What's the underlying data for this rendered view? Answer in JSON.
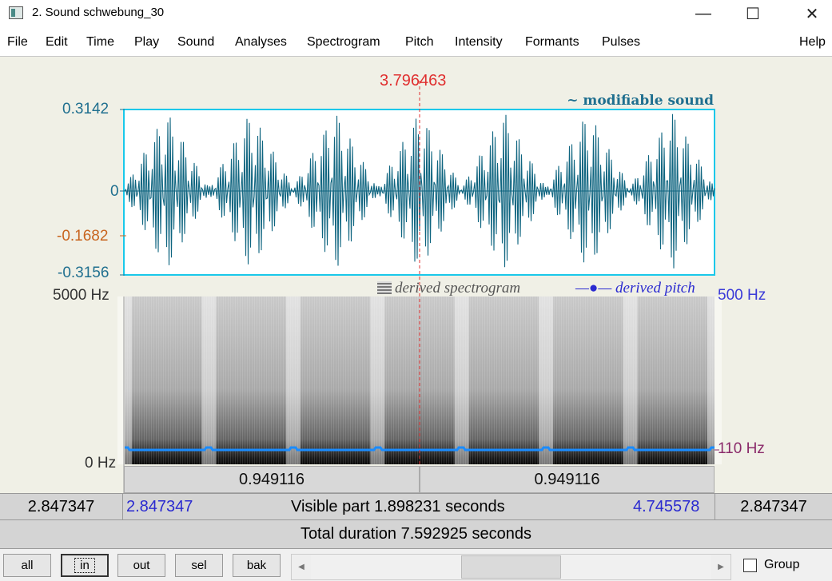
{
  "window": {
    "title": "2. Sound schwebung_30",
    "minimize": "—",
    "maximize": "☐",
    "close": "✕"
  },
  "menu": [
    "File",
    "Edit",
    "Time",
    "Play",
    "Sound",
    "Analyses",
    "Spectrogram",
    "Pitch",
    "Intensity",
    "Formants",
    "Pulses",
    "Help"
  ],
  "cursor_time": "3.796463",
  "waveform": {
    "legend": "~ modifiable sound",
    "y_max": "0.3142",
    "y_zero": "0",
    "y_cursor": "-0.1682",
    "y_min": "-0.3156",
    "beat_count": 7,
    "color": "#0f6580",
    "border_color": "#19c8ea"
  },
  "spectrogram": {
    "legend": "derived spectrogram",
    "freq_max": "5000 Hz",
    "freq_min": "0 Hz"
  },
  "pitch": {
    "legend": "derived pitch",
    "top": "500 Hz",
    "value": "110 Hz",
    "color": "#3344dd",
    "line_color": "#1a8cff"
  },
  "selection": {
    "left_duration": "0.949116",
    "right_duration": "0.949116"
  },
  "visible": {
    "before": "2.847347",
    "start": "2.847347",
    "label": "Visible part 1.898231 seconds",
    "end": "4.745578",
    "after": "2.847347"
  },
  "total": "Total duration 7.592925 seconds",
  "buttons": {
    "all": "all",
    "in": "in",
    "out": "out",
    "sel": "sel",
    "bak": "bak"
  },
  "scroll": {
    "left_arrow": "◀",
    "right_arrow": "▶"
  },
  "group_label": "Group"
}
